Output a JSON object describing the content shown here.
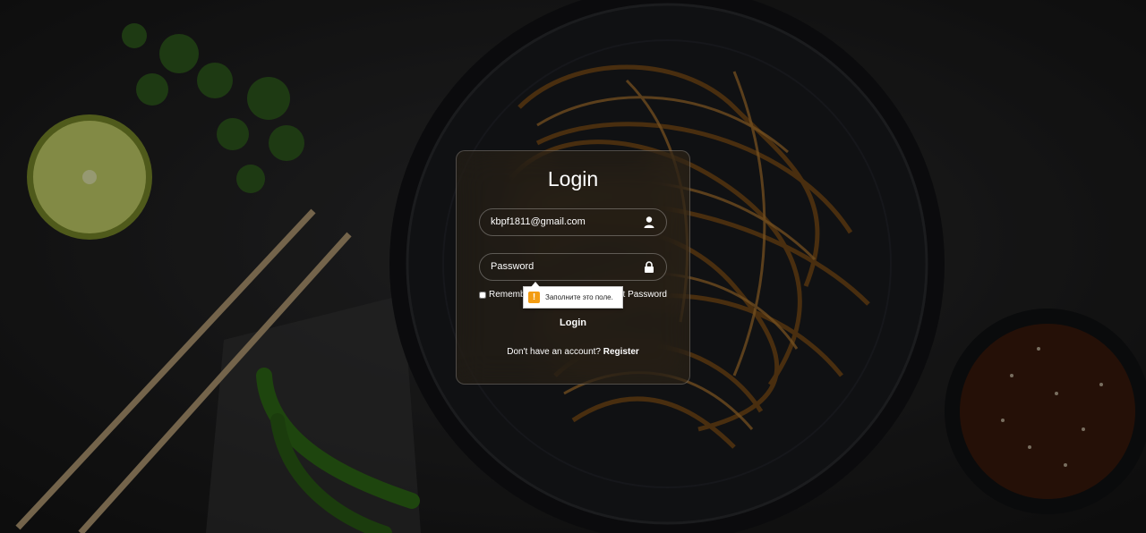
{
  "login_card": {
    "title": "Login",
    "email": {
      "value": "kbpf1811@gmail.com",
      "icon": "user-icon"
    },
    "password": {
      "placeholder": "Password",
      "value": "",
      "icon": "lock-icon"
    },
    "remember_label": "Remember Me",
    "forgot_label": "Forgot Password",
    "login_button": "Login",
    "register_prompt": "Don't have an account?",
    "register_link": "Register"
  },
  "validation_tooltip": {
    "message": "Заполните это поле.",
    "icon": "warning-icon",
    "icon_glyph": "!"
  },
  "colors": {
    "background": "#1c1c1d",
    "text": "#ffffff",
    "warning": "#f39c12"
  }
}
